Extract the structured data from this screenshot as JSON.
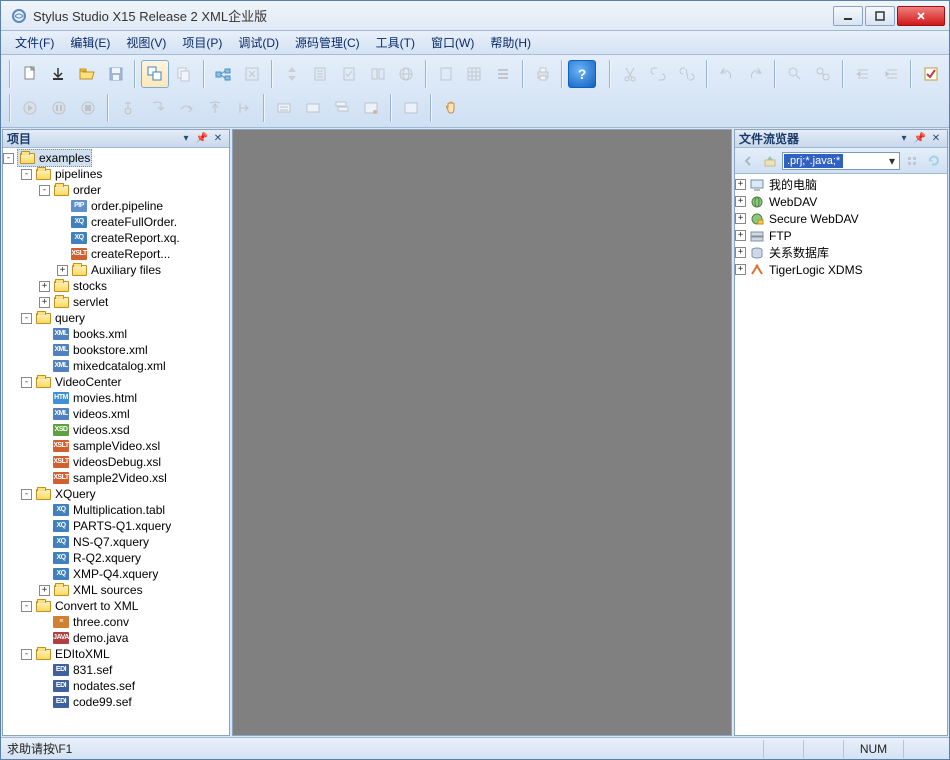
{
  "window": {
    "title": "Stylus Studio X15 Release 2 XML企业版"
  },
  "menu": [
    "文件(F)",
    "编辑(E)",
    "视图(V)",
    "项目(P)",
    "调试(D)",
    "源码管理(C)",
    "工具(T)",
    "窗口(W)",
    "帮助(H)"
  ],
  "panels": {
    "project": {
      "title": "项目"
    },
    "filebrowser": {
      "title": "文件流览器",
      "filter": ".prj;*.java;*",
      "sources": [
        {
          "label": "我的电脑",
          "icon": "computer"
        },
        {
          "label": "WebDAV",
          "icon": "webdav"
        },
        {
          "label": "Secure WebDAV",
          "icon": "webdav-secure"
        },
        {
          "label": "FTP",
          "icon": "ftp"
        },
        {
          "label": "关系数据库",
          "icon": "database"
        },
        {
          "label": "TigerLogic XDMS",
          "icon": "tigerlogic"
        }
      ]
    }
  },
  "tree": {
    "root": {
      "label": "examples",
      "expanded": true
    },
    "nodes": [
      {
        "d": 1,
        "t": "folder",
        "e": "-",
        "label": "pipelines"
      },
      {
        "d": 2,
        "t": "folder",
        "e": "-",
        "label": "order"
      },
      {
        "d": 3,
        "t": "file",
        "ft": "pip",
        "label": "order.pipeline"
      },
      {
        "d": 3,
        "t": "file",
        "ft": "xq",
        "label": "createFullOrder."
      },
      {
        "d": 3,
        "t": "file",
        "ft": "xq",
        "label": "createReport.xq."
      },
      {
        "d": 3,
        "t": "file",
        "ft": "xslt",
        "label": "createReport..."
      },
      {
        "d": 3,
        "t": "folder",
        "e": "+",
        "label": "Auxiliary files"
      },
      {
        "d": 2,
        "t": "folder",
        "e": "+",
        "label": "stocks"
      },
      {
        "d": 2,
        "t": "folder",
        "e": "+",
        "label": "servlet"
      },
      {
        "d": 1,
        "t": "folder",
        "e": "-",
        "label": "query"
      },
      {
        "d": 2,
        "t": "file",
        "ft": "xml",
        "label": "books.xml"
      },
      {
        "d": 2,
        "t": "file",
        "ft": "xml",
        "label": "bookstore.xml"
      },
      {
        "d": 2,
        "t": "file",
        "ft": "xml",
        "label": "mixedcatalog.xml"
      },
      {
        "d": 1,
        "t": "folder",
        "e": "-",
        "label": "VideoCenter"
      },
      {
        "d": 2,
        "t": "file",
        "ft": "html",
        "label": "movies.html"
      },
      {
        "d": 2,
        "t": "file",
        "ft": "xml",
        "label": "videos.xml"
      },
      {
        "d": 2,
        "t": "file",
        "ft": "xsd",
        "label": "videos.xsd"
      },
      {
        "d": 2,
        "t": "file",
        "ft": "xslt",
        "label": "sampleVideo.xsl"
      },
      {
        "d": 2,
        "t": "file",
        "ft": "xslt",
        "label": "videosDebug.xsl"
      },
      {
        "d": 2,
        "t": "file",
        "ft": "xslt",
        "label": "sample2Video.xsl"
      },
      {
        "d": 1,
        "t": "folder",
        "e": "-",
        "label": "XQuery"
      },
      {
        "d": 2,
        "t": "file",
        "ft": "xq",
        "label": "Multiplication.tabl"
      },
      {
        "d": 2,
        "t": "file",
        "ft": "xq",
        "label": "PARTS-Q1.xquery"
      },
      {
        "d": 2,
        "t": "file",
        "ft": "xq",
        "label": "NS-Q7.xquery"
      },
      {
        "d": 2,
        "t": "file",
        "ft": "xq",
        "label": "R-Q2.xquery"
      },
      {
        "d": 2,
        "t": "file",
        "ft": "xq",
        "label": "XMP-Q4.xquery"
      },
      {
        "d": 2,
        "t": "folder",
        "e": "+",
        "label": "XML sources"
      },
      {
        "d": 1,
        "t": "folder",
        "e": "-",
        "label": "Convert to XML"
      },
      {
        "d": 2,
        "t": "file",
        "ft": "conv",
        "label": "three.conv"
      },
      {
        "d": 2,
        "t": "file",
        "ft": "java",
        "label": "demo.java"
      },
      {
        "d": 1,
        "t": "folder",
        "e": "-",
        "label": "EDItoXML"
      },
      {
        "d": 2,
        "t": "file",
        "ft": "edi",
        "label": "831.sef"
      },
      {
        "d": 2,
        "t": "file",
        "ft": "edi",
        "label": "nodates.sef"
      },
      {
        "d": 2,
        "t": "file",
        "ft": "edi",
        "label": "code99.sef"
      }
    ]
  },
  "status": {
    "help": "求助请按\\F1",
    "num": "NUM"
  },
  "filetype_text": {
    "pip": "PIP",
    "xq": "XQ",
    "xslt": "XSLT",
    "xml": "XML",
    "html": "HTM",
    "xsd": "XSD",
    "conv": "≡",
    "java": "JAVA",
    "edi": "EDI"
  }
}
